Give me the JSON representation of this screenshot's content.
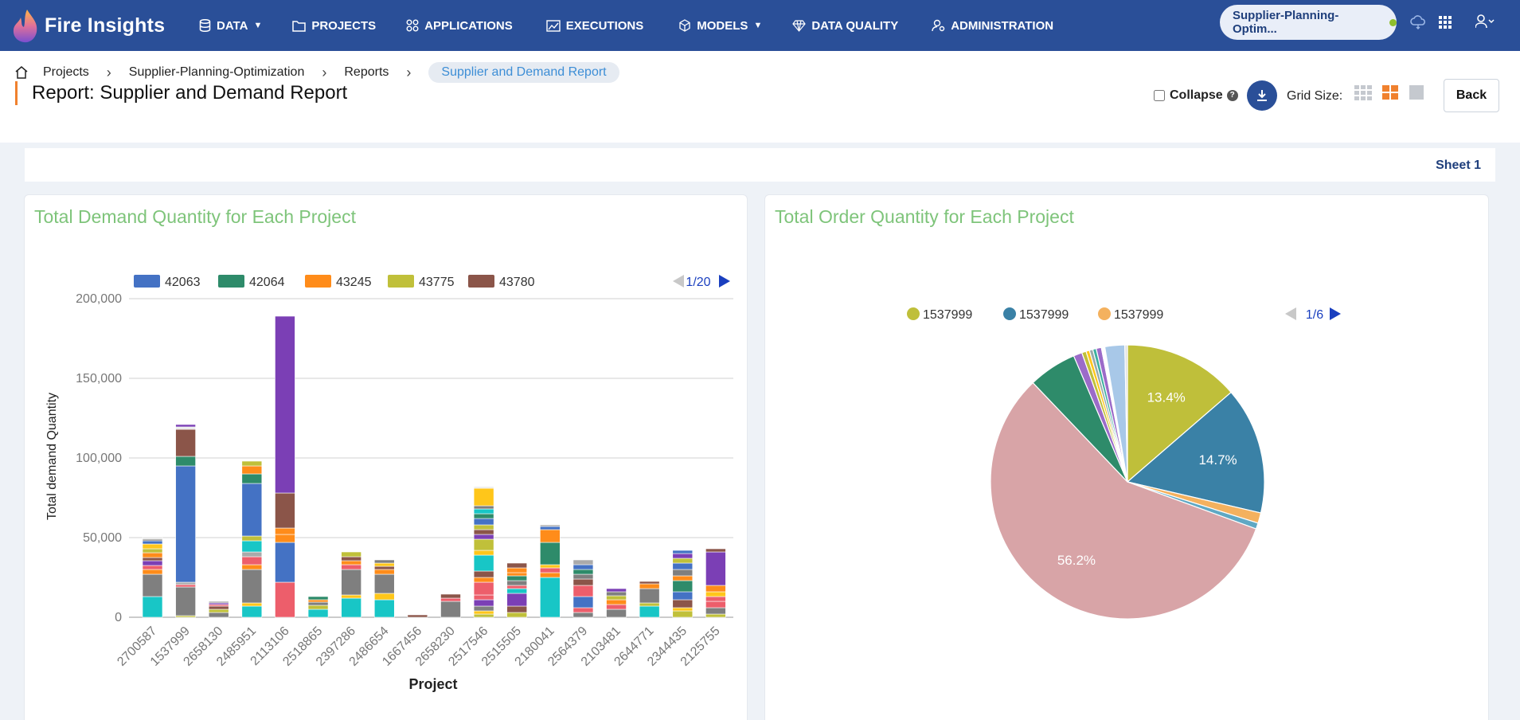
{
  "brand": {
    "name": "Fire Insights"
  },
  "nav": {
    "items": [
      {
        "label": "DATA",
        "icon": "database-icon",
        "dropdown": true
      },
      {
        "label": "PROJECTS",
        "icon": "folder-icon",
        "dropdown": false
      },
      {
        "label": "APPLICATIONS",
        "icon": "apps-icon",
        "dropdown": false
      },
      {
        "label": "EXECUTIONS",
        "icon": "chart-icon",
        "dropdown": false
      },
      {
        "label": "MODELS",
        "icon": "cube-icon",
        "dropdown": true
      },
      {
        "label": "DATA QUALITY",
        "icon": "diamond-icon",
        "dropdown": false
      },
      {
        "label": "ADMINISTRATION",
        "icon": "user-gear-icon",
        "dropdown": false
      }
    ],
    "project_pill": "Supplier-Planning-Optim...",
    "status_color": "#8fbf2c"
  },
  "breadcrumb": {
    "items": [
      "Projects",
      "Supplier-Planning-Optimization",
      "Reports"
    ],
    "current": "Supplier and Demand Report"
  },
  "header": {
    "title": "Report: Supplier and Demand Report",
    "collapse_label": "Collapse",
    "grid_size_label": "Grid Size:",
    "back_label": "Back"
  },
  "sheet": {
    "tab_label": "Sheet 1"
  },
  "colors": {
    "brand": "#2a4f98",
    "accent": "#f0812e",
    "title_green": "#7ec47a"
  },
  "chart_data": [
    {
      "type": "bar",
      "stacked": true,
      "title": "Total Demand Quantity for Each Project",
      "xlabel": "Project",
      "ylabel": "Total demand Quantity",
      "ylim": [
        0,
        200000
      ],
      "yticks": [
        "0",
        "50,000",
        "100,000",
        "150,000",
        "200,000"
      ],
      "grid": true,
      "legend": {
        "position": "top",
        "entries": [
          {
            "name": "42063",
            "color": "#4472c4"
          },
          {
            "name": "42064",
            "color": "#2e8b6a"
          },
          {
            "name": "43245",
            "color": "#ff8c1a"
          },
          {
            "name": "43775",
            "color": "#c0c03a"
          },
          {
            "name": "43780",
            "color": "#8b5549"
          }
        ],
        "page": "1/20"
      },
      "categories": [
        "2700587",
        "1537999",
        "2658130",
        "2485951",
        "2113106",
        "2518865",
        "2397286",
        "2486654",
        "1667456",
        "2658230",
        "2517546",
        "2515505",
        "2180041",
        "2564379",
        "2103481",
        "2644771",
        "2344435",
        "2125755"
      ],
      "stacks": [
        [
          [
            13000,
            "#18c6c6"
          ],
          [
            14000,
            "#7f7f7f"
          ],
          [
            3000,
            "#ff8c1a"
          ],
          [
            2500,
            "#ed5e6b"
          ],
          [
            3000,
            "#7b3fb5"
          ],
          [
            2000,
            "#8b5549"
          ],
          [
            3000,
            "#ff8c1a"
          ],
          [
            2500,
            "#c0c03a"
          ],
          [
            3000,
            "#ffc61a"
          ],
          [
            2000,
            "#4472c4"
          ],
          [
            1000,
            "#7f7f7f"
          ],
          [
            1500,
            "#e8e8e8"
          ]
        ],
        [
          [
            1000,
            "#c0c03a"
          ],
          [
            18000,
            "#7f7f7f"
          ],
          [
            1500,
            "#ed5e6b"
          ],
          [
            1500,
            "#aaa"
          ],
          [
            73000,
            "#4472c4"
          ],
          [
            6000,
            "#2e8b6a"
          ],
          [
            17000,
            "#8b5549"
          ],
          [
            1500,
            "#e8e8e8"
          ],
          [
            1500,
            "#7b3fb5"
          ]
        ],
        [
          [
            3000,
            "#7f7f7f"
          ],
          [
            2000,
            "#c0c03a"
          ],
          [
            2000,
            "#8b5549"
          ],
          [
            1000,
            "#ed5e6b"
          ],
          [
            1000,
            "#7b3fb5"
          ],
          [
            1000,
            "#aaa"
          ]
        ],
        [
          [
            7000,
            "#18c6c6"
          ],
          [
            2000,
            "#ffc61a"
          ],
          [
            21000,
            "#7f7f7f"
          ],
          [
            3000,
            "#ff8c1a"
          ],
          [
            5000,
            "#ed5e6b"
          ],
          [
            3000,
            "#aaa"
          ],
          [
            7000,
            "#18c6c6"
          ],
          [
            3000,
            "#c0c03a"
          ],
          [
            33000,
            "#4472c4"
          ],
          [
            6000,
            "#2e8b6a"
          ],
          [
            5000,
            "#ff8c1a"
          ],
          [
            3000,
            "#c0c03a"
          ]
        ],
        [
          [
            22000,
            "#ed5e6b"
          ],
          [
            25000,
            "#4472c4"
          ],
          [
            5000,
            "#ff8c1a"
          ],
          [
            4000,
            "#ff8c1a"
          ],
          [
            22000,
            "#8b5549"
          ],
          [
            111000,
            "#7b3fb5"
          ]
        ],
        [
          [
            5000,
            "#18c6c6"
          ],
          [
            2500,
            "#c0c03a"
          ],
          [
            2000,
            "#7f7f7f"
          ],
          [
            1500,
            "#ff8c1a"
          ],
          [
            2000,
            "#2e8b6a"
          ]
        ],
        [
          [
            12000,
            "#18c6c6"
          ],
          [
            2000,
            "#ffc61a"
          ],
          [
            16000,
            "#7f7f7f"
          ],
          [
            3000,
            "#ed5e6b"
          ],
          [
            2500,
            "#ff8c1a"
          ],
          [
            2500,
            "#8b5549"
          ],
          [
            3000,
            "#c0c03a"
          ]
        ],
        [
          [
            11000,
            "#18c6c6"
          ],
          [
            4000,
            "#ffc61a"
          ],
          [
            12000,
            "#7f7f7f"
          ],
          [
            3000,
            "#ff8c1a"
          ],
          [
            2000,
            "#8b5549"
          ],
          [
            2000,
            "#ffc61a"
          ],
          [
            2000,
            "#7f7f7f"
          ]
        ],
        [
          [
            1500,
            "#8b5549"
          ]
        ],
        [
          [
            10000,
            "#7f7f7f"
          ],
          [
            2000,
            "#ed5e6b"
          ],
          [
            2500,
            "#8b5549"
          ]
        ],
        [
          [
            2000,
            "#c0c03a"
          ],
          [
            2000,
            "#ffc61a"
          ],
          [
            3000,
            "#7f7f7f"
          ],
          [
            4000,
            "#7b3fb5"
          ],
          [
            3000,
            "#ed5e6b"
          ],
          [
            8000,
            "#ed5e6b"
          ],
          [
            3000,
            "#ff8c1a"
          ],
          [
            4000,
            "#8b5549"
          ],
          [
            10000,
            "#18c6c6"
          ],
          [
            3000,
            "#ffc61a"
          ],
          [
            7000,
            "#c0c03a"
          ],
          [
            3000,
            "#7b3fb5"
          ],
          [
            3000,
            "#8b5549"
          ],
          [
            3000,
            "#c0c03a"
          ],
          [
            4000,
            "#4472c4"
          ],
          [
            3000,
            "#2e8b6a"
          ],
          [
            3000,
            "#18c6c6"
          ],
          [
            2000,
            "#7f7f7f"
          ],
          [
            11000,
            "#ffc61a"
          ],
          [
            1000,
            "#e8e8e8"
          ]
        ],
        [
          [
            3000,
            "#c0c03a"
          ],
          [
            4000,
            "#8b5549"
          ],
          [
            8000,
            "#7b3fb5"
          ],
          [
            3000,
            "#18c6c6"
          ],
          [
            2000,
            "#ed5e6b"
          ],
          [
            3000,
            "#7f7f7f"
          ],
          [
            3000,
            "#2e8b6a"
          ],
          [
            2000,
            "#ff8c1a"
          ],
          [
            3000,
            "#ff8c1a"
          ],
          [
            3000,
            "#8b5549"
          ]
        ],
        [
          [
            25000,
            "#18c6c6"
          ],
          [
            3000,
            "#ff8c1a"
          ],
          [
            3000,
            "#ed5e6b"
          ],
          [
            2000,
            "#ffc61a"
          ],
          [
            14000,
            "#2e8b6a"
          ],
          [
            8000,
            "#ff8c1a"
          ],
          [
            2000,
            "#4472c4"
          ],
          [
            1000,
            "#aaa"
          ]
        ],
        [
          [
            3000,
            "#7f7f7f"
          ],
          [
            3000,
            "#ed5e6b"
          ],
          [
            7000,
            "#4472c4"
          ],
          [
            7000,
            "#ed5e6b"
          ],
          [
            4000,
            "#8b5549"
          ],
          [
            3000,
            "#7f7f7f"
          ],
          [
            3000,
            "#2e8b6a"
          ],
          [
            3000,
            "#4472c4"
          ],
          [
            3000,
            "#aaa"
          ]
        ],
        [
          [
            5000,
            "#7f7f7f"
          ],
          [
            3000,
            "#ed5e6b"
          ],
          [
            3000,
            "#ff8c1a"
          ],
          [
            2500,
            "#c0c03a"
          ],
          [
            2500,
            "#7f7f7f"
          ],
          [
            2000,
            "#7b3fb5"
          ]
        ],
        [
          [
            7000,
            "#18c6c6"
          ],
          [
            2000,
            "#c0c03a"
          ],
          [
            9000,
            "#7f7f7f"
          ],
          [
            3000,
            "#ff8c1a"
          ],
          [
            1500,
            "#8b5549"
          ]
        ],
        [
          [
            4000,
            "#c0c03a"
          ],
          [
            2000,
            "#ffc61a"
          ],
          [
            5000,
            "#8b5549"
          ],
          [
            5000,
            "#4472c4"
          ],
          [
            7000,
            "#2e8b6a"
          ],
          [
            3000,
            "#ff8c1a"
          ],
          [
            4000,
            "#7f7f7f"
          ],
          [
            4000,
            "#4472c4"
          ],
          [
            3000,
            "#c0c03a"
          ],
          [
            3000,
            "#7b3fb5"
          ],
          [
            2000,
            "#4472c4"
          ]
        ],
        [
          [
            2000,
            "#c0c03a"
          ],
          [
            4000,
            "#7f7f7f"
          ],
          [
            4000,
            "#ed5e6b"
          ],
          [
            3000,
            "#ed5e6b"
          ],
          [
            3000,
            "#ffc61a"
          ],
          [
            4000,
            "#ff8c1a"
          ],
          [
            21000,
            "#7b3fb5"
          ],
          [
            2000,
            "#8b5549"
          ]
        ]
      ]
    },
    {
      "type": "pie",
      "title": "Total Order Quantity for Each Project",
      "legend": {
        "position": "top",
        "entries": [
          {
            "name": "1537999",
            "color": "#bfbf3a"
          },
          {
            "name": "1537999",
            "color": "#3a81a6"
          },
          {
            "name": "1537999",
            "color": "#f4b15e"
          }
        ],
        "page": "1/6"
      },
      "slices": [
        {
          "value": 13.4,
          "color": "#bfbf3a",
          "label": "13.4%"
        },
        {
          "value": 14.7,
          "color": "#3a81a6",
          "label": "14.7%"
        },
        {
          "value": 1.2,
          "color": "#f4b15e",
          "label": ""
        },
        {
          "value": 0.7,
          "color": "#5fa8c4",
          "label": ""
        },
        {
          "value": 56.2,
          "color": "#d8a4a7",
          "label": "56.2%"
        },
        {
          "value": 5.6,
          "color": "#2e8b6a",
          "label": ""
        },
        {
          "value": 1.0,
          "color": "#9b6bc9",
          "label": ""
        },
        {
          "value": 0.5,
          "color": "#c0c03a",
          "label": ""
        },
        {
          "value": 0.4,
          "color": "#ffc61a",
          "label": ""
        },
        {
          "value": 0.4,
          "color": "#9aa",
          "label": ""
        },
        {
          "value": 0.4,
          "color": "#3cb0a0",
          "label": ""
        },
        {
          "value": 0.6,
          "color": "#9b6bc9",
          "label": ""
        },
        {
          "value": 0.4,
          "color": "#ffffff",
          "label": ""
        },
        {
          "value": 2.3,
          "color": "#a8c8e8",
          "label": ""
        },
        {
          "value": 0.3,
          "color": "#e0e0e0",
          "label": ""
        }
      ]
    }
  ]
}
